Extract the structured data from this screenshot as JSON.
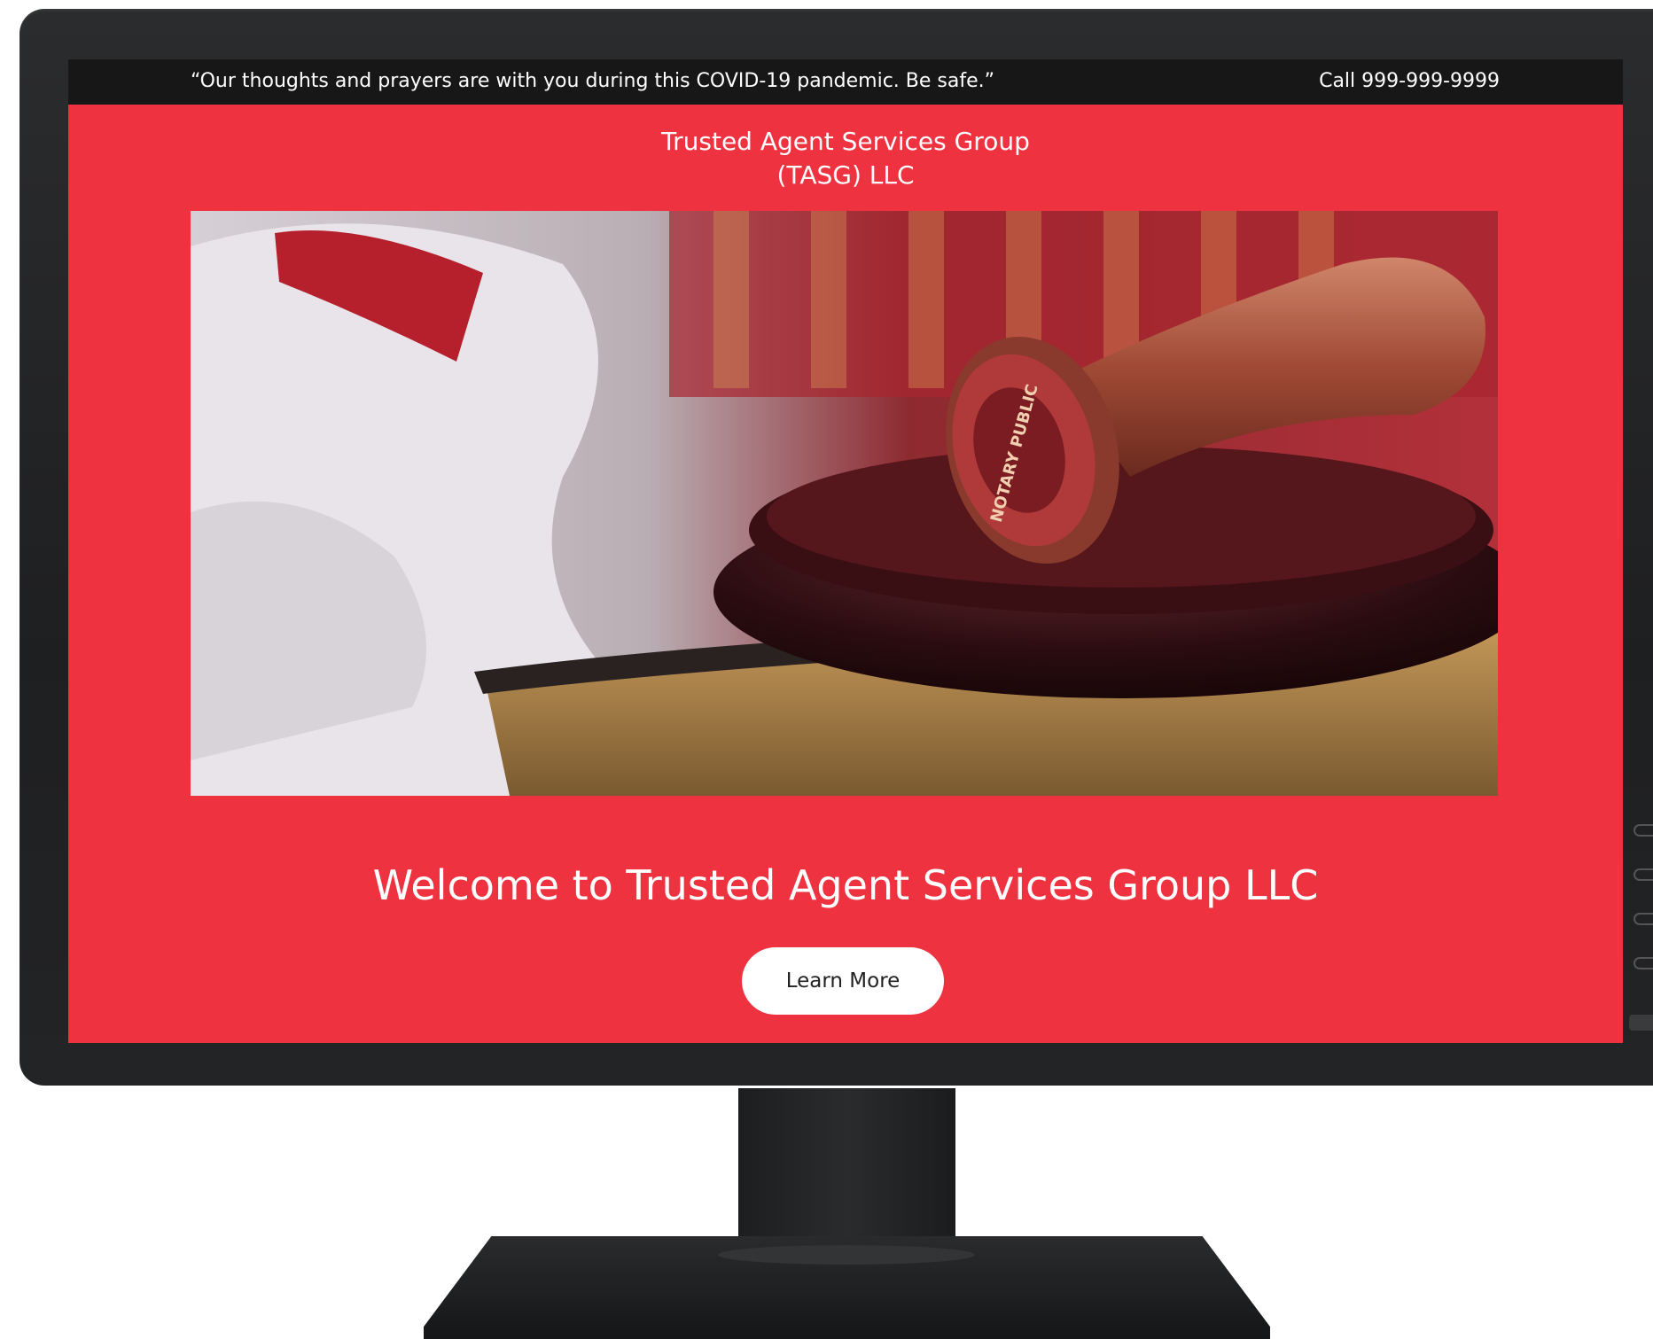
{
  "topbar": {
    "message": "“Our thoughts and prayers are with you during this COVID-19 pandemic. Be safe.”",
    "phone": "Call 999-999-9999"
  },
  "brand": {
    "line1": "Trusted Agent Services Group",
    "line2": "(TASG) LLC"
  },
  "hero": {
    "stamp_text": "NOTARY PUBLIC"
  },
  "main": {
    "welcome": "Welcome to Trusted Agent Services Group LLC",
    "cta_label": "Learn More"
  },
  "colors": {
    "accent": "#ee3240",
    "topbar": "#171717"
  }
}
